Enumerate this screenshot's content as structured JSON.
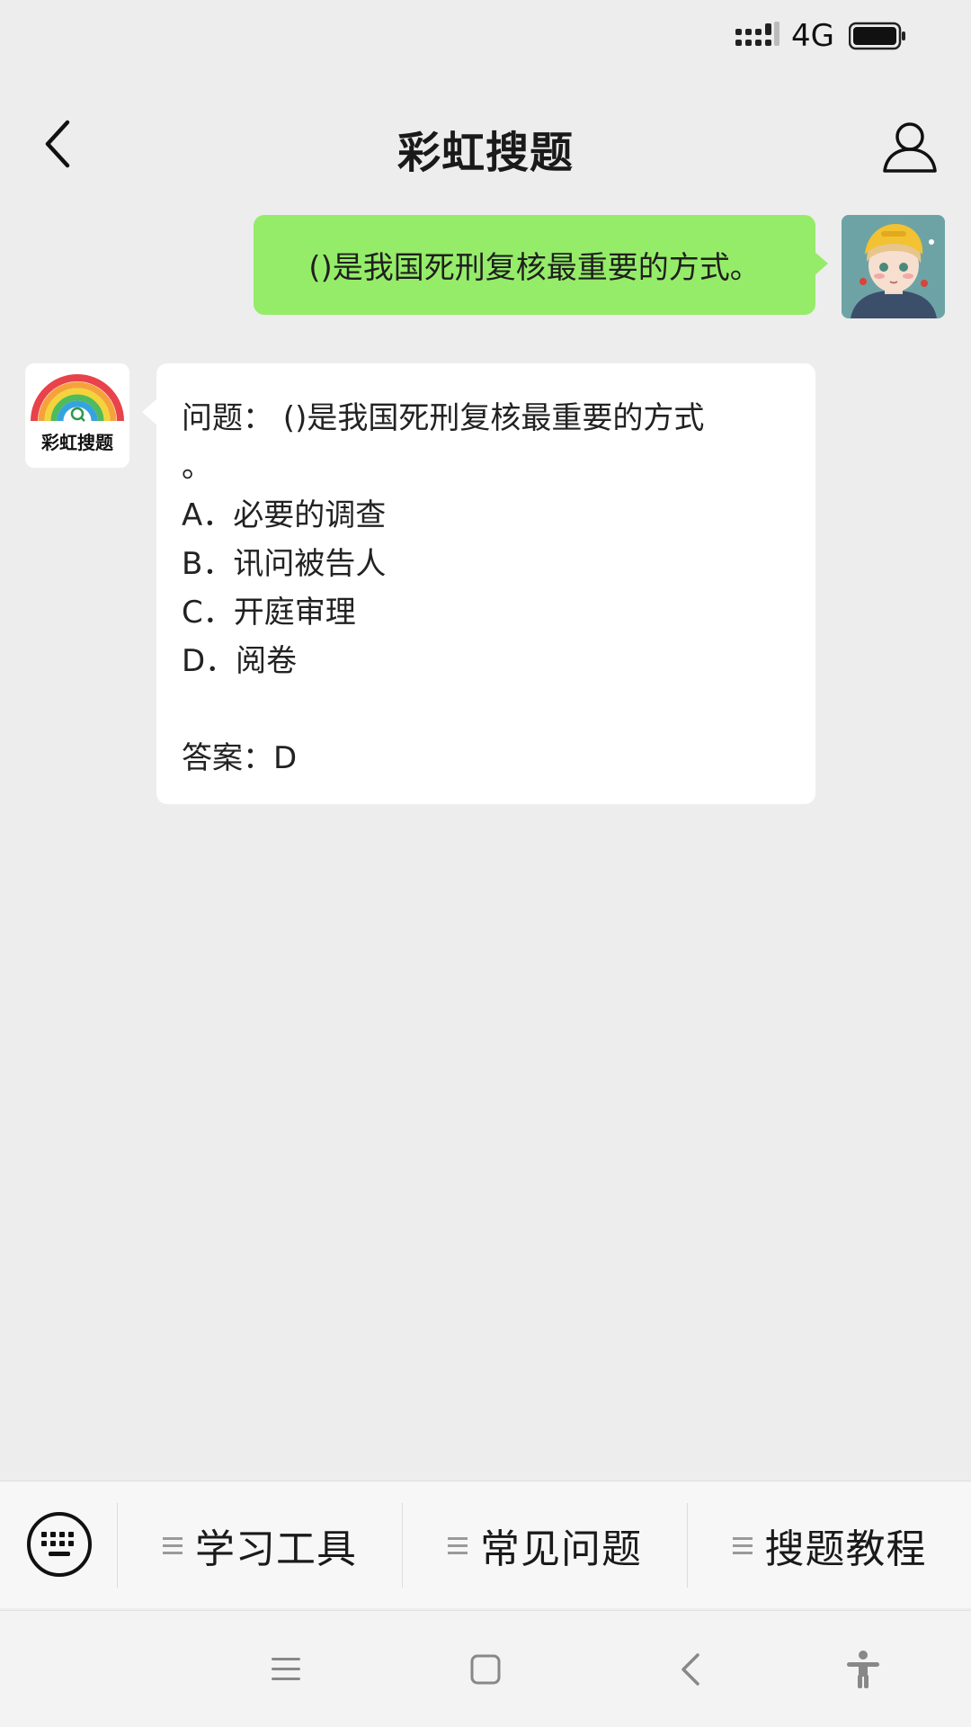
{
  "status_bar": {
    "network": "4G"
  },
  "header": {
    "title": "彩虹搜题"
  },
  "chat": {
    "user_message": "()是我国死刑复核最重要的方式。",
    "bot_logo_text": "彩虹搜题",
    "bot_reply": {
      "question_line1": "问题：  ()是我国死刑复核最重要的方式",
      "question_line2": "。",
      "option_a": "A．必要的调查",
      "option_b": "B．讯问被告人",
      "option_c": "C．开庭审理",
      "option_d": "D．阅卷",
      "answer": "答案：D"
    }
  },
  "menu": {
    "items": [
      {
        "label": "学习工具"
      },
      {
        "label": "常见问题"
      },
      {
        "label": "搜题教程"
      }
    ]
  },
  "colors": {
    "background": "#ededed",
    "outgoing_bubble": "#95ec69",
    "incoming_bubble": "#ffffff"
  },
  "icons": {
    "back": "chevron-left-icon",
    "profile": "person-icon",
    "keyboard": "keyboard-icon",
    "menu": "menu-lines-icon",
    "nav_menu": "hamburger-icon",
    "nav_home": "square-icon",
    "nav_back": "chevron-left-icon",
    "nav_accessibility": "accessibility-icon"
  }
}
